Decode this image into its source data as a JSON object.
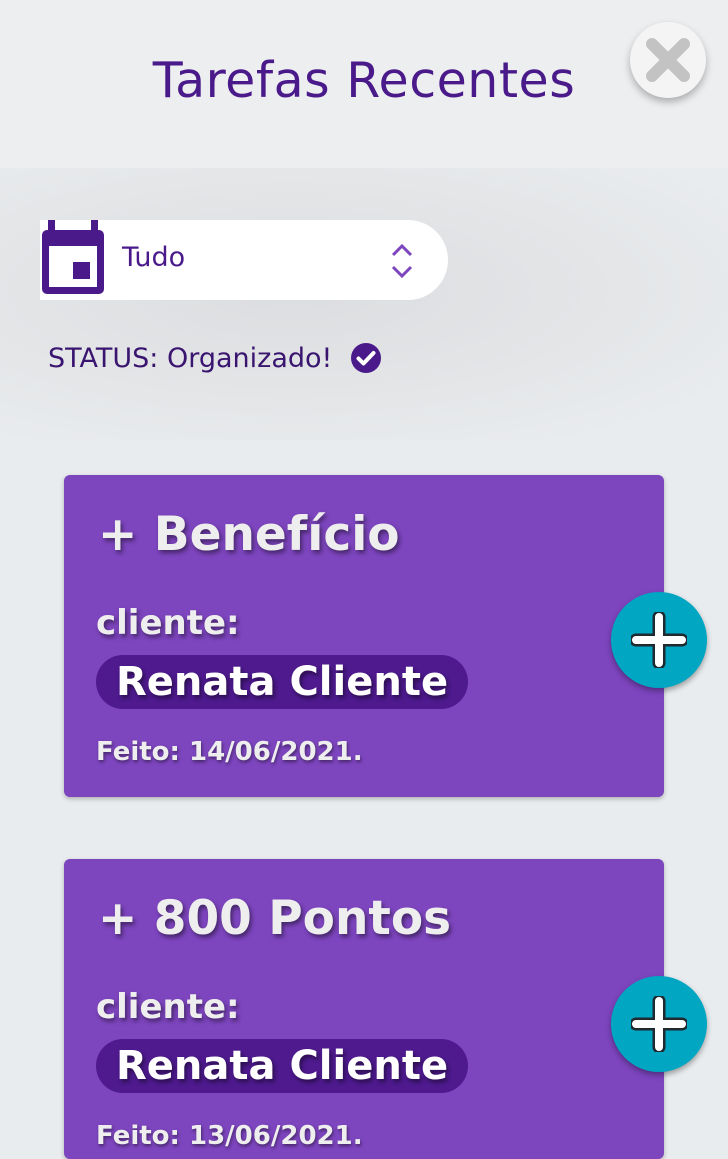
{
  "header": {
    "title": "Tarefas Recentes",
    "close_icon": "close-x-icon"
  },
  "filter": {
    "calendar_icon": "calendar-icon",
    "selected_value": "Tudo",
    "arrows_icon": "chevron-up-down-icon"
  },
  "status": {
    "text": "STATUS: Organizado!",
    "icon": "check-circle-icon"
  },
  "tasks": [
    {
      "title": "+ Benefício",
      "client_label": "cliente:",
      "client_name": "Renata Cliente",
      "date": "Feito: 14/06/2021.",
      "action_icon": "plus-icon"
    },
    {
      "title": "+ 800 Pontos",
      "client_label": "cliente:",
      "client_name": "Renata Cliente",
      "date": "Feito: 13/06/2021.",
      "action_icon": "plus-icon"
    }
  ],
  "colors": {
    "primary": "#4a1a8a",
    "card": "#7d45be",
    "pill": "#4e1a8e",
    "accent": "#00a6c2",
    "background": "#e9ecef"
  }
}
